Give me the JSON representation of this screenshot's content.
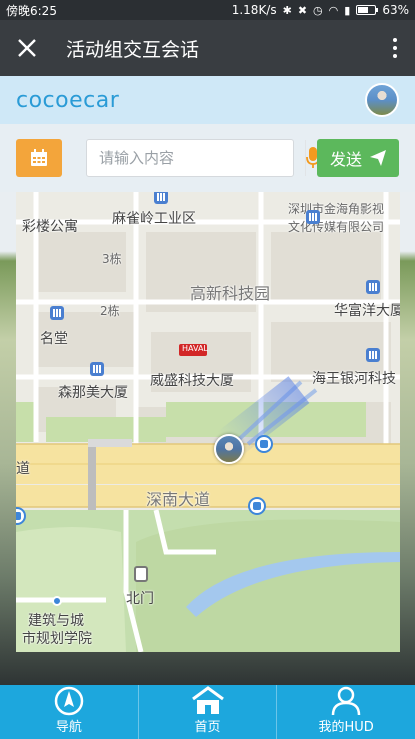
{
  "status_bar": {
    "time": "傍晚6:25",
    "speed": "1.18K/s",
    "battery": "63%",
    "battery_level": 0.63
  },
  "title_bar": {
    "title": "活动组交互会话"
  },
  "brand": {
    "logo_text": "cocoecar"
  },
  "input_row": {
    "placeholder": "请输入内容",
    "value": "",
    "send_label": "发送"
  },
  "map": {
    "labels": {
      "l1": "彩楼公寓",
      "l2": "麻雀岭工业区",
      "l3": "深圳市金海角影视",
      "l4": "文化传媒有限公司",
      "l5": "3栋",
      "l6": "高新科技园",
      "l7": "2栋",
      "l8": "华富洋大厦",
      "l9": "名堂",
      "l10": "威盛科技大厦",
      "l11": "海王银河科技",
      "l12": "森那美大厦",
      "l13": "深南大道",
      "l14": "道",
      "l15": "北门",
      "l16": "建筑与城",
      "l17": "市规划学院",
      "l18": "HAVAL"
    }
  },
  "bottom_nav": [
    {
      "label": "导航",
      "icon": "compass-icon"
    },
    {
      "label": "首页",
      "icon": "home-icon"
    },
    {
      "label": "我的HUD",
      "icon": "user-icon"
    }
  ],
  "colors": {
    "accent": "#1da7dd",
    "send": "#5cb85c",
    "calendar": "#f3a53b",
    "titlebar": "#393d41"
  }
}
